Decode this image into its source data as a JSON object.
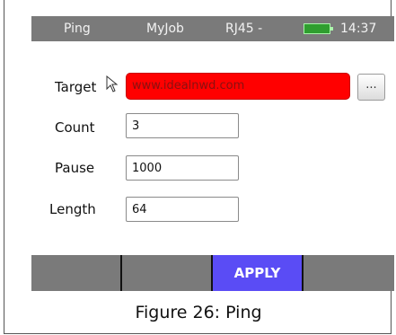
{
  "statusbar": {
    "title": "Ping",
    "job": "MyJob",
    "port": "RJ45 -",
    "time": "14:37",
    "battery_color": "#2f9e2f"
  },
  "form": {
    "target_label": "Target",
    "target_value": "www.idealnwd.com",
    "more_label": "...",
    "count_label": "Count",
    "count_value": "3",
    "pause_label": "Pause",
    "pause_value": "1000",
    "length_label": "Length",
    "length_value": "64"
  },
  "softkeys": {
    "apply_label": "APPLY",
    "apply_color": "#5a4cf5"
  },
  "caption": "Figure 26: Ping"
}
